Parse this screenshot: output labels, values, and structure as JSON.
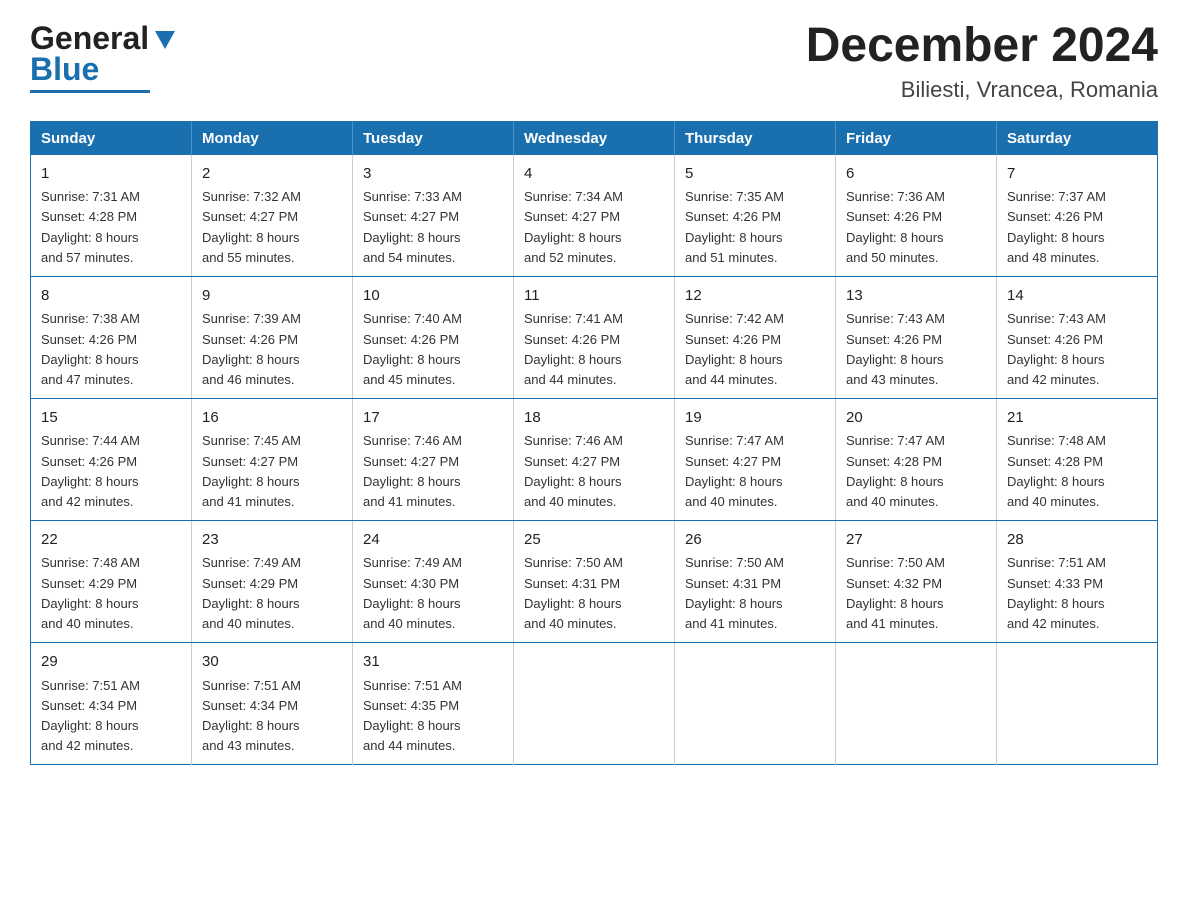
{
  "header": {
    "logo_general": "General",
    "logo_blue": "Blue",
    "month_title": "December 2024",
    "location": "Biliesti, Vrancea, Romania"
  },
  "calendar": {
    "days_of_week": [
      "Sunday",
      "Monday",
      "Tuesday",
      "Wednesday",
      "Thursday",
      "Friday",
      "Saturday"
    ],
    "weeks": [
      [
        {
          "day": "1",
          "info": "Sunrise: 7:31 AM\nSunset: 4:28 PM\nDaylight: 8 hours\nand 57 minutes."
        },
        {
          "day": "2",
          "info": "Sunrise: 7:32 AM\nSunset: 4:27 PM\nDaylight: 8 hours\nand 55 minutes."
        },
        {
          "day": "3",
          "info": "Sunrise: 7:33 AM\nSunset: 4:27 PM\nDaylight: 8 hours\nand 54 minutes."
        },
        {
          "day": "4",
          "info": "Sunrise: 7:34 AM\nSunset: 4:27 PM\nDaylight: 8 hours\nand 52 minutes."
        },
        {
          "day": "5",
          "info": "Sunrise: 7:35 AM\nSunset: 4:26 PM\nDaylight: 8 hours\nand 51 minutes."
        },
        {
          "day": "6",
          "info": "Sunrise: 7:36 AM\nSunset: 4:26 PM\nDaylight: 8 hours\nand 50 minutes."
        },
        {
          "day": "7",
          "info": "Sunrise: 7:37 AM\nSunset: 4:26 PM\nDaylight: 8 hours\nand 48 minutes."
        }
      ],
      [
        {
          "day": "8",
          "info": "Sunrise: 7:38 AM\nSunset: 4:26 PM\nDaylight: 8 hours\nand 47 minutes."
        },
        {
          "day": "9",
          "info": "Sunrise: 7:39 AM\nSunset: 4:26 PM\nDaylight: 8 hours\nand 46 minutes."
        },
        {
          "day": "10",
          "info": "Sunrise: 7:40 AM\nSunset: 4:26 PM\nDaylight: 8 hours\nand 45 minutes."
        },
        {
          "day": "11",
          "info": "Sunrise: 7:41 AM\nSunset: 4:26 PM\nDaylight: 8 hours\nand 44 minutes."
        },
        {
          "day": "12",
          "info": "Sunrise: 7:42 AM\nSunset: 4:26 PM\nDaylight: 8 hours\nand 44 minutes."
        },
        {
          "day": "13",
          "info": "Sunrise: 7:43 AM\nSunset: 4:26 PM\nDaylight: 8 hours\nand 43 minutes."
        },
        {
          "day": "14",
          "info": "Sunrise: 7:43 AM\nSunset: 4:26 PM\nDaylight: 8 hours\nand 42 minutes."
        }
      ],
      [
        {
          "day": "15",
          "info": "Sunrise: 7:44 AM\nSunset: 4:26 PM\nDaylight: 8 hours\nand 42 minutes."
        },
        {
          "day": "16",
          "info": "Sunrise: 7:45 AM\nSunset: 4:27 PM\nDaylight: 8 hours\nand 41 minutes."
        },
        {
          "day": "17",
          "info": "Sunrise: 7:46 AM\nSunset: 4:27 PM\nDaylight: 8 hours\nand 41 minutes."
        },
        {
          "day": "18",
          "info": "Sunrise: 7:46 AM\nSunset: 4:27 PM\nDaylight: 8 hours\nand 40 minutes."
        },
        {
          "day": "19",
          "info": "Sunrise: 7:47 AM\nSunset: 4:27 PM\nDaylight: 8 hours\nand 40 minutes."
        },
        {
          "day": "20",
          "info": "Sunrise: 7:47 AM\nSunset: 4:28 PM\nDaylight: 8 hours\nand 40 minutes."
        },
        {
          "day": "21",
          "info": "Sunrise: 7:48 AM\nSunset: 4:28 PM\nDaylight: 8 hours\nand 40 minutes."
        }
      ],
      [
        {
          "day": "22",
          "info": "Sunrise: 7:48 AM\nSunset: 4:29 PM\nDaylight: 8 hours\nand 40 minutes."
        },
        {
          "day": "23",
          "info": "Sunrise: 7:49 AM\nSunset: 4:29 PM\nDaylight: 8 hours\nand 40 minutes."
        },
        {
          "day": "24",
          "info": "Sunrise: 7:49 AM\nSunset: 4:30 PM\nDaylight: 8 hours\nand 40 minutes."
        },
        {
          "day": "25",
          "info": "Sunrise: 7:50 AM\nSunset: 4:31 PM\nDaylight: 8 hours\nand 40 minutes."
        },
        {
          "day": "26",
          "info": "Sunrise: 7:50 AM\nSunset: 4:31 PM\nDaylight: 8 hours\nand 41 minutes."
        },
        {
          "day": "27",
          "info": "Sunrise: 7:50 AM\nSunset: 4:32 PM\nDaylight: 8 hours\nand 41 minutes."
        },
        {
          "day": "28",
          "info": "Sunrise: 7:51 AM\nSunset: 4:33 PM\nDaylight: 8 hours\nand 42 minutes."
        }
      ],
      [
        {
          "day": "29",
          "info": "Sunrise: 7:51 AM\nSunset: 4:34 PM\nDaylight: 8 hours\nand 42 minutes."
        },
        {
          "day": "30",
          "info": "Sunrise: 7:51 AM\nSunset: 4:34 PM\nDaylight: 8 hours\nand 43 minutes."
        },
        {
          "day": "31",
          "info": "Sunrise: 7:51 AM\nSunset: 4:35 PM\nDaylight: 8 hours\nand 44 minutes."
        },
        {
          "day": "",
          "info": ""
        },
        {
          "day": "",
          "info": ""
        },
        {
          "day": "",
          "info": ""
        },
        {
          "day": "",
          "info": ""
        }
      ]
    ]
  }
}
